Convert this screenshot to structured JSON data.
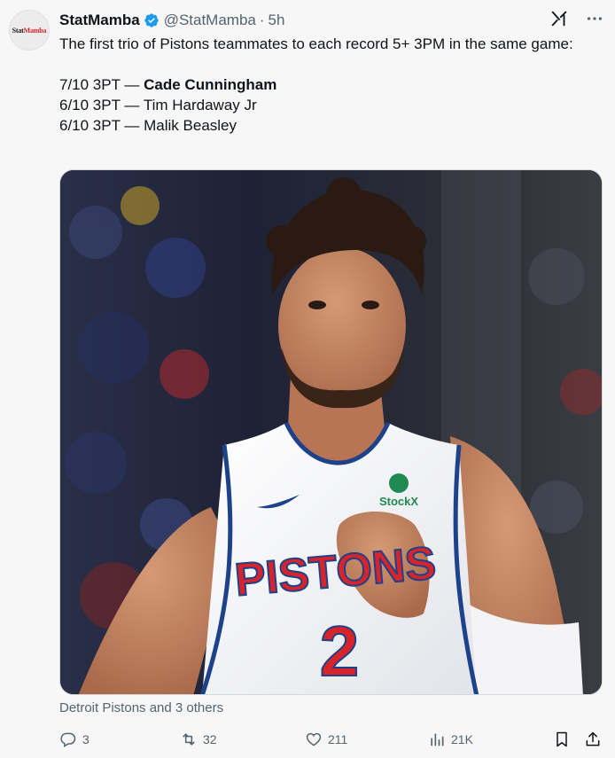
{
  "tweet": {
    "avatar_text_1": "Stat",
    "avatar_text_2": "Mamba",
    "display_name": "StatMamba",
    "handle": "@StatMamba",
    "separator": "·",
    "time": "5h",
    "verified_icon": "verified-badge-icon",
    "text_line_1": "The first trio of Pistons teammates to each record 5+ 3PM in the same game:",
    "stat_1_prefix": "7/10 3PT — ",
    "stat_1_name": "Cade Cunningham",
    "stat_2": "6/10 3PT — Tim Hardaway Jr",
    "stat_3": "6/10 3PT — Malik Beasley",
    "media_tags": "Detroit Pistons and 3 others",
    "jersey_team": "PISTONS",
    "jersey_number": "2",
    "jersey_sponsor": "StockX"
  },
  "actions": {
    "reply_count": "3",
    "retweet_count": "32",
    "like_count": "211",
    "views_count": "21K"
  },
  "colors": {
    "text": "#0f1419",
    "secondary": "#536471",
    "verified": "#1d9bf0",
    "pistons_red": "#d8232a",
    "pistons_blue": "#1d428a"
  }
}
